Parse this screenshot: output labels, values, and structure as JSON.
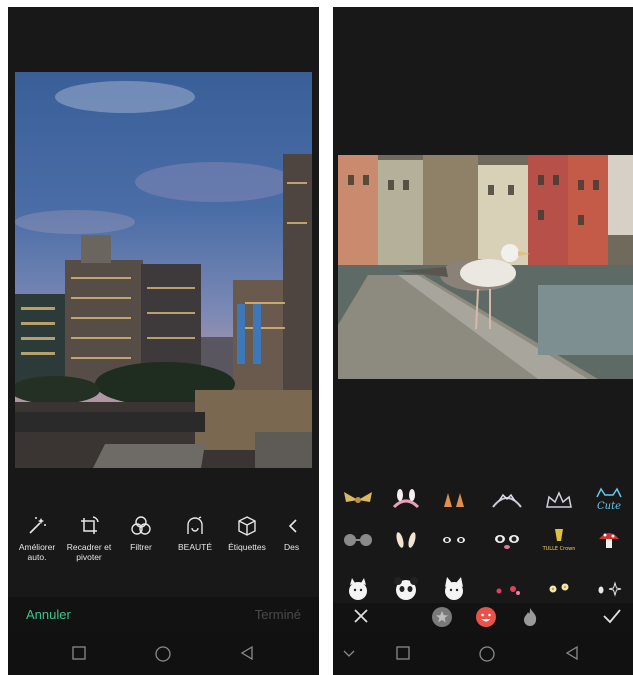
{
  "left_screen": {
    "tools": [
      {
        "label": "Améliorer\nauto.",
        "icon": "magic-wand-icon"
      },
      {
        "label": "Recadrer et\npivoter",
        "icon": "crop-rotate-icon"
      },
      {
        "label": "Filtrer",
        "icon": "filter-circles-icon"
      },
      {
        "label": "BEAUTÉ",
        "icon": "beauty-face-icon"
      },
      {
        "label": "Étiquettes",
        "icon": "sticker-cube-icon"
      },
      {
        "label": "Des",
        "icon": "draw-icon"
      }
    ],
    "cancel_label": "Annuler",
    "done_label": "Terminé",
    "accent_color": "#37c78b"
  },
  "right_screen": {
    "stickers": [
      "bow-sticker",
      "bunny-ears-sticker",
      "fox-ears-sticker",
      "tiara-sticker",
      "crown-sticker",
      "cute-cat-text-sticker",
      "sunglasses-sticker",
      "rabbit-ears-sticker",
      "eyes-sticker",
      "cat-face-sticker",
      "tulle-crown-sticker",
      "mushroom-sticker",
      "white-cat-sticker",
      "panda-sticker",
      "cat-head-sticker",
      "hearts-sticker",
      "flowers-sticker",
      "sparkle-sticker"
    ],
    "tulle_sticker_text": "TULLE Crown",
    "cute_sticker_text": "Cute",
    "tab_icons": [
      "close-icon",
      "star-category-icon",
      "emoji-category-icon",
      "flame-category-icon",
      "check-icon"
    ]
  },
  "system_nav": [
    "recent-apps-icon",
    "home-icon",
    "back-icon"
  ]
}
